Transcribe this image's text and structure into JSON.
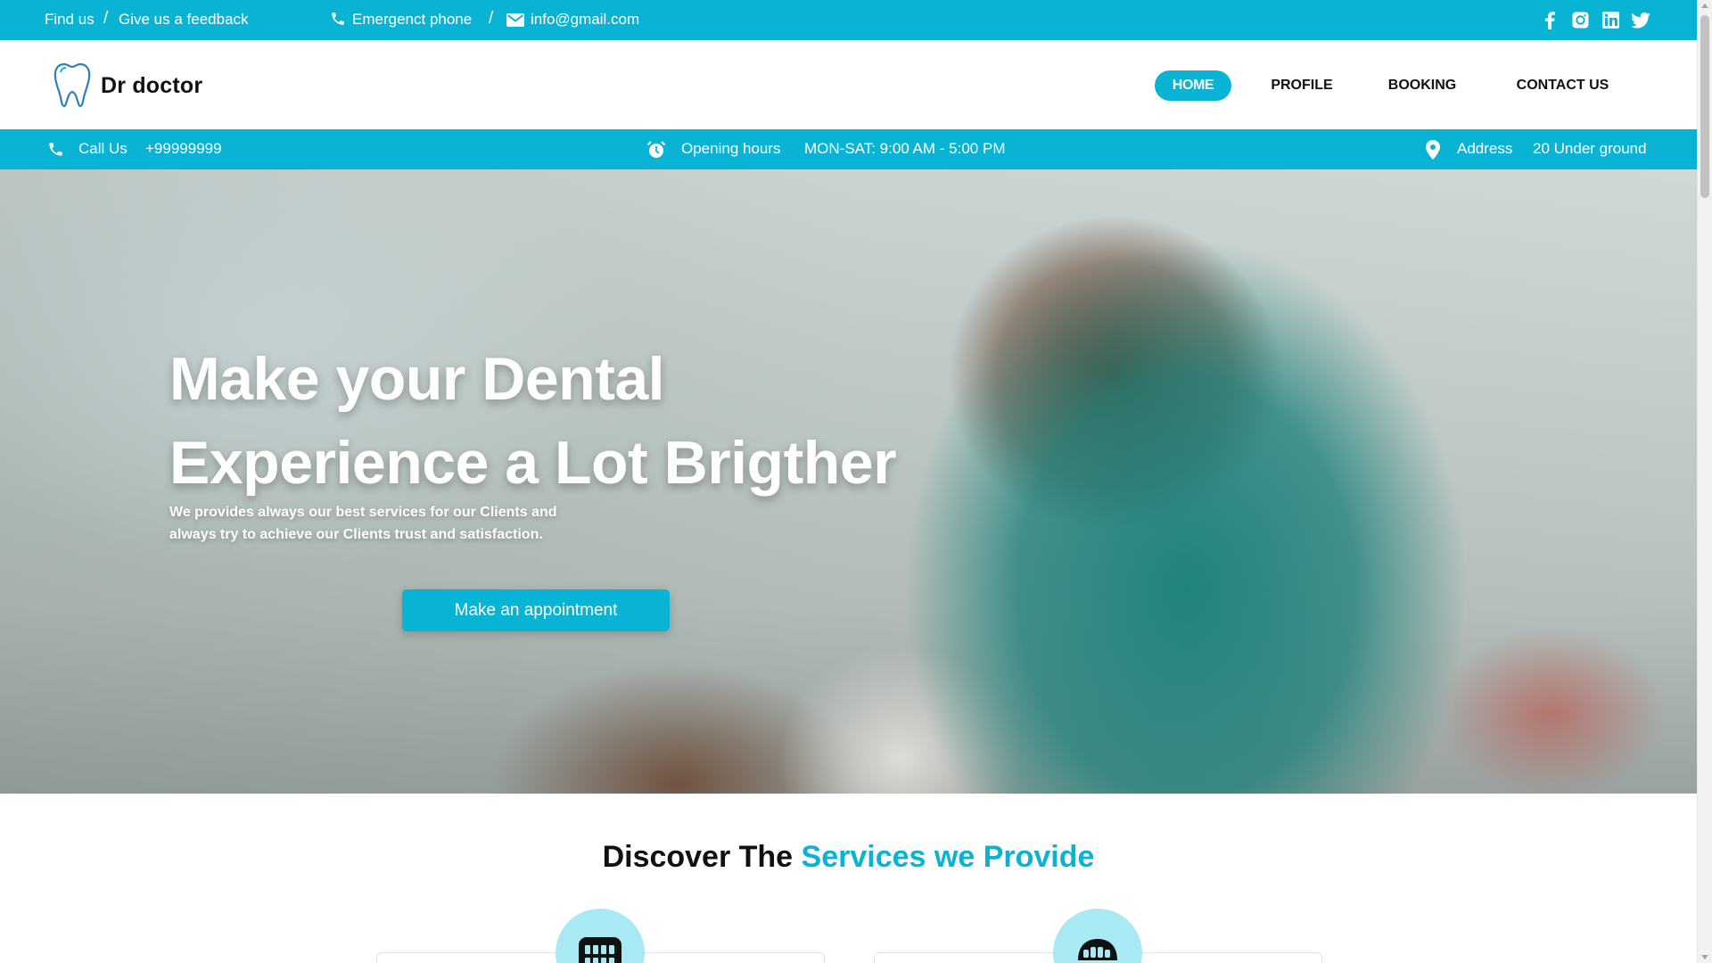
{
  "topbar": {
    "find_us": "Find us",
    "separator": "/",
    "feedback": "Give us a feedback",
    "phone_label": "Emergenct phone",
    "email": "info@gmail.com",
    "social_icons": [
      "facebook-icon",
      "instagram-icon",
      "linkedin-icon",
      "twitter-icon"
    ]
  },
  "header": {
    "logo_text": "Dr doctor",
    "nav": [
      "HOME",
      "PROFILE",
      "BOOKING",
      "CONTACT US"
    ],
    "active_nav": "HOME"
  },
  "infobar": {
    "call_label": "Call Us",
    "call_number": "+99999999",
    "hours_label": "Opening hours",
    "hours_value": "MON-SAT: 9:00 AM - 5:00 PM",
    "address_label": "Address",
    "address_value": "20 Under ground"
  },
  "hero": {
    "title_line1": "Make your Dental",
    "title_line2": "Experience a Lot Brigther",
    "subtitle_line1": "We provides always our best services for our Clients and",
    "subtitle_line2": "always try to achieve our Clients trust and satisfaction.",
    "button": "Make an appointment"
  },
  "services": {
    "title_dark": "Discover The",
    "title_accent": "Services we Provide",
    "icons": [
      "teeth-grid-icon",
      "denture-icon"
    ]
  },
  "colors": {
    "accent": "#09b3d3",
    "circle": "#a9e9f4"
  }
}
